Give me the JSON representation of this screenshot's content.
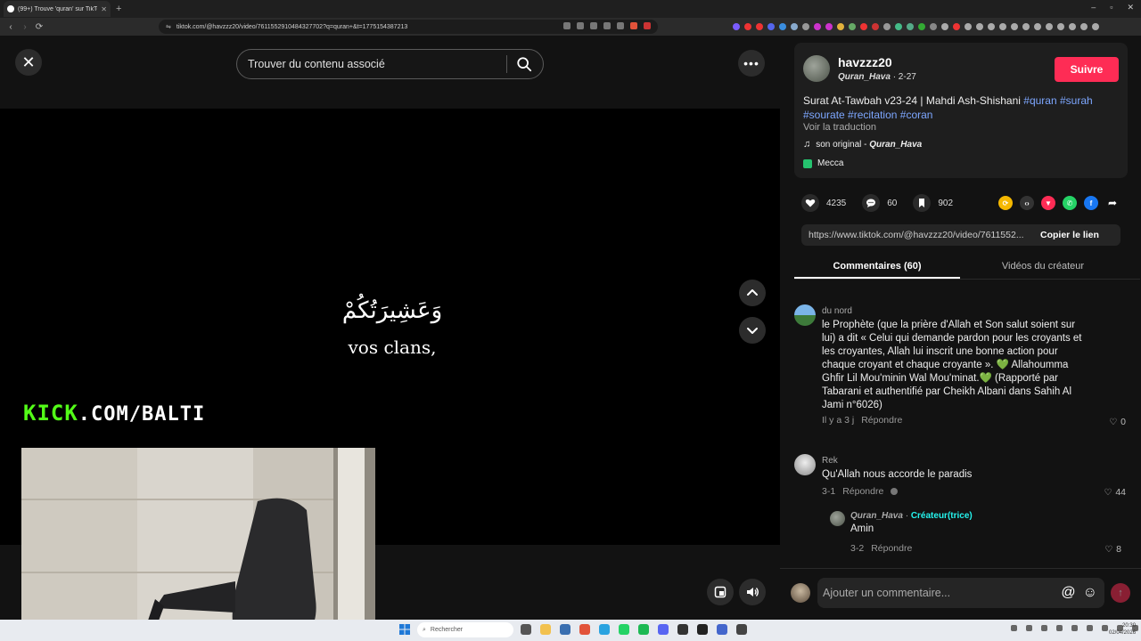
{
  "browser": {
    "tab_title": "(99+) Trouve 'quran' sur TikTok",
    "new_tab": "+",
    "url": "tiktok.com/@havzzz20/video/7611552910484327702?q=quran+&t=1775154387213",
    "window_controls": [
      "–",
      "▫",
      "✕"
    ]
  },
  "video": {
    "search_placeholder": "Trouver du contenu associé",
    "arabic_text": "وَعَشِيرَتُكُمْ",
    "caption_text": "vos clans,",
    "overlay_kick_brand": "KICK",
    "overlay_kick_rest": ".COM/BALTI"
  },
  "creator": {
    "username": "havzzz20",
    "nickname": "Quran_Hava",
    "date": "· 2-27",
    "follow_label": "Suivre",
    "description_text": "Surat At-Tawbah v23-24 | Mahdi Ash-Shishani ",
    "hashtags": [
      "#quran",
      "#surah",
      "#sourate",
      "#recitation",
      "#coran"
    ],
    "translate_label": "Voir la traduction",
    "music_prefix": "son original - ",
    "music_author": "Quran_Hava",
    "location": "Mecca"
  },
  "stats": {
    "likes": "4235",
    "comments": "60",
    "saves": "902"
  },
  "link": {
    "url": "https://www.tiktok.com/@havzzz20/video/7611552...",
    "copy_label": "Copier le lien"
  },
  "tabs": {
    "comments": "Commentaires (60)",
    "creator_videos": "Vidéos du créateur"
  },
  "comments": [
    {
      "name": "du nord",
      "text": "le Prophète (que la prière d'Allah et Son salut soient sur lui) a dit « Celui qui demande pardon pour les croyants et les croyantes, Allah lui inscrit une bonne action pour chaque croyant et chaque croyante ». 💚 Allahoumma Ghfir Lil Mou'minin Wal Mou'minat.💚 (Rapporté par Tabarani et authentifié par Cheikh Albani dans Sahih Al Jami n°6026)",
      "time": "Il y a 3 j",
      "reply_label": "Répondre",
      "likes": "0"
    },
    {
      "name": "Rek",
      "text": "Qu'Allah nous accorde le paradis",
      "time": "3-1",
      "reply_label": "Répondre",
      "likes": "44"
    }
  ],
  "reply": {
    "name": "Quran_Hava",
    "badge": "Créateur(trice)",
    "text": "Amin",
    "time": "3-2",
    "reply_label": "Répondre",
    "likes": "8"
  },
  "comment_input": {
    "placeholder": "Ajouter un commentaire..."
  },
  "taskbar": {
    "search_placeholder": "Rechercher",
    "time": "20:30",
    "date": "02/04/2026"
  },
  "colors": {
    "follow": "#fe2c55",
    "hashtag": "#7da7ff",
    "kick_green": "#53fc18",
    "creator_badge": "#25f4ee"
  }
}
